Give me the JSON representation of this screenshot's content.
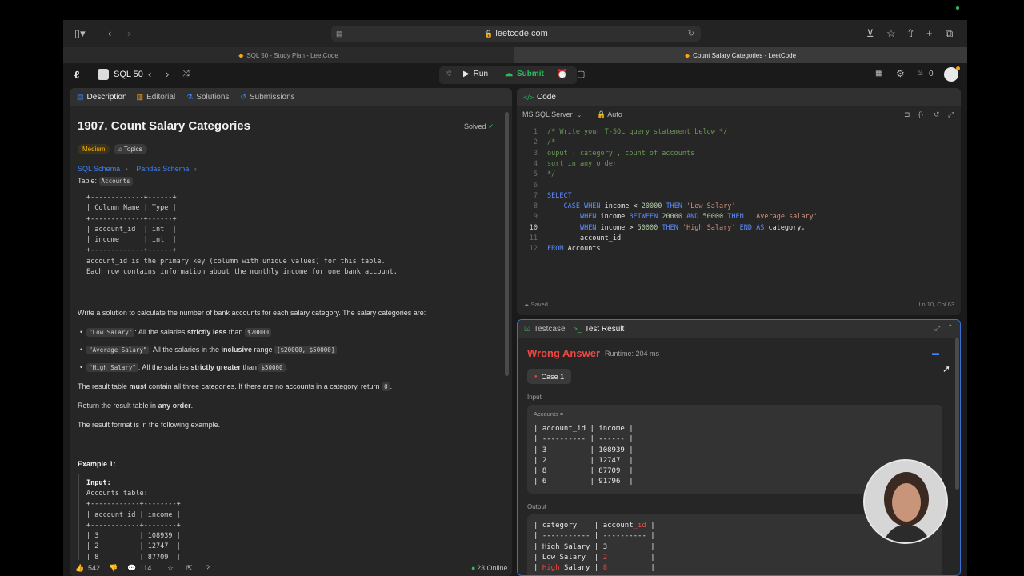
{
  "browser": {
    "url": "leetcode.com",
    "tabs": [
      "SQL 50 - Study Plan - LeetCode",
      "Count Salary Categories - LeetCode"
    ]
  },
  "appbar": {
    "list_name": "SQL 50",
    "run_label": "Run",
    "submit_label": "Submit",
    "streak": "0"
  },
  "left_tabs": [
    "Description",
    "Editorial",
    "Solutions",
    "Submissions"
  ],
  "problem": {
    "title": "1907. Count Salary Categories",
    "status": "Solved",
    "difficulty": "Medium",
    "topics": "Topics",
    "schema_links": [
      "SQL Schema",
      "Pandas Schema"
    ],
    "table_label": "Table:",
    "table_name": "Accounts",
    "schema_block": "+-------------+------+\n| Column Name | Type |\n+-------------+------+\n| account_id  | int  |\n| income      | int  |\n+-------------+------+\naccount_id is the primary key (column with unique values) for this table.\nEach row contains information about the monthly income for one bank account.",
    "intro": "Write a solution to calculate the number of bank accounts for each salary category. The salary categories are:",
    "bullets": [
      {
        "code": "\"Low Salary\"",
        "pre": ": All the salaries ",
        "bold": "strictly less",
        "post": " than ",
        "code2": "$20000",
        "end": "."
      },
      {
        "code": "\"Average Salary\"",
        "pre": ": All the salaries in the ",
        "bold": "inclusive",
        "post": " range ",
        "code2": "[$20000, $50000]",
        "end": "."
      },
      {
        "code": "\"High Salary\"",
        "pre": ": All the salaries ",
        "bold": "strictly greater",
        "post": " than ",
        "code2": "$50000",
        "end": "."
      }
    ],
    "p_must_pre": "The result table ",
    "p_must_bold": "must",
    "p_must_post": " contain all three categories. If there are no accounts in a category, return ",
    "p_must_code": "0",
    "p_must_end": ".",
    "p_order_pre": "Return the result table in ",
    "p_order_bold": "any order",
    "p_order_end": ".",
    "p_format": "The result format is in the following example.",
    "example_title": "Example 1:",
    "example_input_label": "Input:",
    "example_block": "Accounts table:\n+------------+--------+\n| account_id | income |\n+------------+--------+\n| 3          | 108939 |\n| 2          | 12747  |\n| 8          | 87709  |"
  },
  "footer": {
    "likes": "542",
    "comments": "114",
    "online": "23 Online"
  },
  "code_pane": {
    "tab": "Code",
    "language": "MS SQL Server",
    "mode": "Auto",
    "saved": "Saved",
    "cursor": "Ln 10, Col 63"
  },
  "result_pane": {
    "tabs": [
      "Testcase",
      "Test Result"
    ],
    "verdict": "Wrong Answer",
    "runtime": "Runtime: 204 ms",
    "case": "Case 1",
    "input_label": "Input",
    "input_var": "Accounts =",
    "input_block": "| account_id | income |\n| ---------- | ------ |\n| 3          | 108939 |\n| 2          | 12747  |\n| 8          | 87709  |\n| 6          | 91796  |",
    "output_label": "Output",
    "output_header_a": "| category    | account",
    "output_header_b": "_id",
    "output_header_c": " |",
    "output_sep": "| ----------- | ---------- |",
    "output_rows": [
      {
        "a": "| High Salary | 3",
        "b": "",
        "c": "          |"
      },
      {
        "a": "| Low Salary  | ",
        "b": "2",
        "c": "          |"
      },
      {
        "a": "| ",
        "b": "High",
        "c": " Salary | ",
        "d": "8",
        "e": "          |"
      }
    ]
  },
  "colors": {
    "accent_green": "#2cbb5d",
    "accent_orange": "#ffa116",
    "wrong_red": "#ef4743",
    "link_blue": "#3b82f6"
  }
}
